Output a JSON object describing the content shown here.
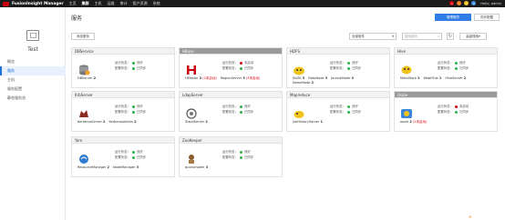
{
  "topbar": {
    "brand": "FusionInsight Manager",
    "nav": [
      "主页",
      "集群",
      "主机",
      "运维",
      "审计",
      "租户资源",
      "系统"
    ],
    "active_index": 1,
    "alarm_counts": [
      "0",
      "1",
      "2",
      "0"
    ],
    "user": "Hello, admin"
  },
  "sidebar": {
    "cluster_name": "Test",
    "items": [
      "概览",
      "服务",
      "主机",
      "服务配置",
      "静态服务池"
    ],
    "active_index": 1
  },
  "main": {
    "title": "服务",
    "add_button": "添加服务",
    "manage_button": "管理服务",
    "sync_button": "同步配置",
    "filter": "全部组件",
    "search_placeholder": "搜索服务",
    "advanced": "高级搜索"
  },
  "status_labels": {
    "running": "运行状态：",
    "config": "配置状态："
  },
  "colors": {
    "good": "#2fb24b",
    "bad": "#d9000b"
  },
  "services": [
    {
      "name": "DBService",
      "icon": "db-icon",
      "running": "良好",
      "running_color": "#2fb24b",
      "config": "已同步",
      "config_color": "#2fb24b",
      "stopped": false,
      "roles": [
        {
          "name": "DBServer",
          "count": "2"
        }
      ]
    },
    {
      "name": "HBase",
      "icon": "hbase-icon",
      "running": "未启动",
      "running_color": "#d9000b",
      "config": "已同步",
      "config_color": "#2fb24b",
      "stopped": true,
      "roles": [
        {
          "name": "HMaster",
          "count": "2",
          "note": "(2未启动)"
        },
        {
          "name": "RegionServer",
          "count": "3",
          "note": "(3未启动)"
        }
      ]
    },
    {
      "name": "HDFS",
      "icon": "hdfs-icon",
      "running": "良好",
      "running_color": "#2fb24b",
      "config": "已同步",
      "config_color": "#2fb24b",
      "stopped": false,
      "roles": [
        {
          "name": "JN/ZK",
          "count": "3"
        },
        {
          "name": "DataNode",
          "count": "3"
        },
        {
          "name": "JournalNode",
          "count": "3"
        },
        {
          "name": "NameNode",
          "count": "2"
        }
      ]
    },
    {
      "name": "Hive",
      "icon": "hive-icon",
      "running": "良好",
      "running_color": "#2fb24b",
      "config": "已同步",
      "config_color": "#2fb24b",
      "stopped": false,
      "roles": [
        {
          "name": "MetaStore",
          "count": "2"
        },
        {
          "name": "WebHCat",
          "count": "1"
        },
        {
          "name": "HiveServer",
          "count": "2"
        }
      ]
    },
    {
      "name": "KrbServer",
      "icon": "krb-icon",
      "running": "良好",
      "running_color": "#2fb24b",
      "config": "已同步",
      "config_color": "#2fb24b",
      "stopped": false,
      "roles": [
        {
          "name": "KerberosServer",
          "count": "2"
        },
        {
          "name": "KerberosAdmin",
          "count": "2"
        }
      ]
    },
    {
      "name": "LdapServer",
      "icon": "ldap-icon",
      "running": "良好",
      "running_color": "#2fb24b",
      "config": "已同步",
      "config_color": "#2fb24b",
      "stopped": false,
      "roles": [
        {
          "name": "SlapdServer",
          "count": "2"
        }
      ]
    },
    {
      "name": "Mapreduce",
      "icon": "mr-icon",
      "running": "良好",
      "running_color": "#2fb24b",
      "config": "已同步",
      "config_color": "#2fb24b",
      "stopped": false,
      "roles": [
        {
          "name": "JobHistoryServer",
          "count": "1"
        }
      ]
    },
    {
      "name": "Oozie",
      "icon": "oozie-icon",
      "running": "未启动",
      "running_color": "#d9000b",
      "config": "已同步",
      "config_color": "#2fb24b",
      "stopped": true,
      "roles": [
        {
          "name": "oozie",
          "count": "2",
          "note": "(2未启动)"
        }
      ]
    },
    {
      "name": "Yarn",
      "icon": "yarn-icon",
      "running": "良好",
      "running_color": "#2fb24b",
      "config": "已同步",
      "config_color": "#2fb24b",
      "stopped": false,
      "roles": [
        {
          "name": "ResourceManager",
          "count": "2"
        },
        {
          "name": "NodeManager",
          "count": "3"
        }
      ]
    },
    {
      "name": "ZooKeeper",
      "icon": "zk-icon",
      "running": "良好",
      "running_color": "#2fb24b",
      "config": "已同步",
      "config_color": "#2fb24b",
      "stopped": false,
      "roles": [
        {
          "name": "quorumpeer",
          "count": "3"
        }
      ]
    }
  ]
}
